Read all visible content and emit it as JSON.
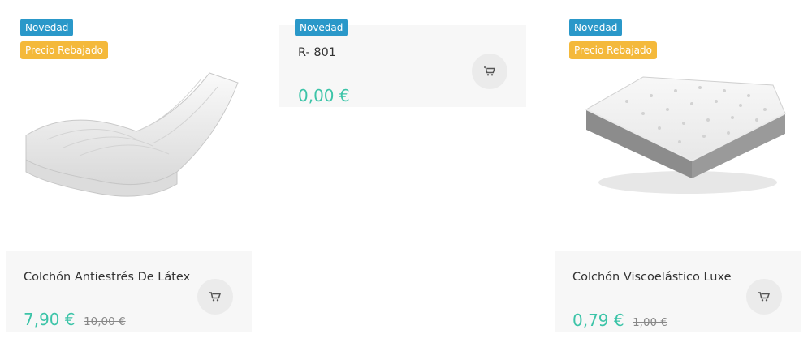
{
  "products": [
    {
      "name": "Colchón Antiestrés De Látex",
      "price": "7,90 €",
      "old_price": "10,00 €",
      "badges": [
        "Novedad",
        "Precio Rebajado"
      ],
      "image": "latex-mattress-image"
    },
    {
      "name": "R- 801",
      "price": "0,00 €",
      "badges": [
        "Novedad"
      ]
    },
    {
      "name": "Colchón Viscoelástico Luxe",
      "price": "0,79 €",
      "old_price": "1,00 €",
      "badges": [
        "Novedad",
        "Precio Rebajado"
      ],
      "image": "luxe-mattress-image"
    }
  ],
  "colors": {
    "badge_new": "#2a98c9",
    "badge_sale": "#f4b93b",
    "price": "#3cc4a8",
    "card_bg": "#f7f7f7"
  },
  "icons": {
    "cart": "shopping-cart-icon"
  }
}
